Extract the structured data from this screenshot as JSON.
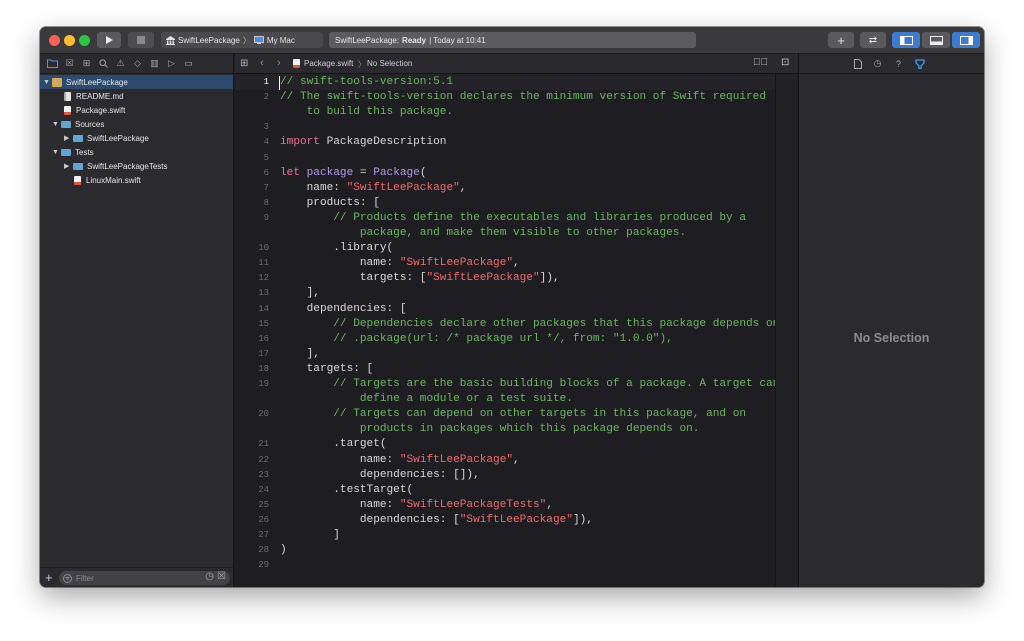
{
  "toolbar": {
    "scheme": "SwiftLeePackage",
    "destination": "My Mac",
    "status_prefix": "SwiftLeePackage:",
    "status_state": "Ready",
    "status_time": "| Today at 10:41"
  },
  "sidebar": {
    "items": [
      {
        "label": "SwiftLeePackage"
      },
      {
        "label": "README.md"
      },
      {
        "label": "Package.swift"
      },
      {
        "label": "Sources"
      },
      {
        "label": "SwiftLeePackage"
      },
      {
        "label": "Tests"
      },
      {
        "label": "SwiftLeePackageTests"
      },
      {
        "label": "LinuxMain.swift"
      }
    ],
    "filter_placeholder": "Filter"
  },
  "jumpbar": {
    "file": "Package.swift",
    "selection": "No Selection"
  },
  "editor": {
    "current_line": 1,
    "lines": [
      {
        "num": "1",
        "tokens": [
          {
            "t": "// swift-tools-version:5.1",
            "c": "c"
          }
        ]
      },
      {
        "num": "2",
        "tokens": [
          {
            "t": "// The swift-tools-version declares the minimum version of Swift required",
            "c": "c"
          }
        ]
      },
      {
        "num": "",
        "tokens": [
          {
            "t": "    to build this package.",
            "c": "c"
          }
        ]
      },
      {
        "num": "3",
        "tokens": []
      },
      {
        "num": "4",
        "tokens": [
          {
            "t": "import",
            "c": "k"
          },
          {
            "t": " PackageDescription",
            "c": "n"
          }
        ]
      },
      {
        "num": "5",
        "tokens": []
      },
      {
        "num": "6",
        "tokens": [
          {
            "t": "let",
            "c": "k"
          },
          {
            "t": " package",
            "c": "t"
          },
          {
            "t": " = ",
            "c": "n"
          },
          {
            "t": "Package",
            "c": "t"
          },
          {
            "t": "(",
            "c": "n"
          }
        ]
      },
      {
        "num": "7",
        "tokens": [
          {
            "t": "    name: ",
            "c": "n"
          },
          {
            "t": "\"SwiftLeePackage\"",
            "c": "s"
          },
          {
            "t": ",",
            "c": "n"
          }
        ]
      },
      {
        "num": "8",
        "tokens": [
          {
            "t": "    products: [",
            "c": "n"
          }
        ]
      },
      {
        "num": "9",
        "tokens": [
          {
            "t": "        // Products define the executables and libraries produced by a",
            "c": "c"
          }
        ]
      },
      {
        "num": "",
        "tokens": [
          {
            "t": "            package, and make them visible to other packages.",
            "c": "c"
          }
        ]
      },
      {
        "num": "10",
        "tokens": [
          {
            "t": "        .library(",
            "c": "n"
          }
        ]
      },
      {
        "num": "11",
        "tokens": [
          {
            "t": "            name: ",
            "c": "n"
          },
          {
            "t": "\"SwiftLeePackage\"",
            "c": "s"
          },
          {
            "t": ",",
            "c": "n"
          }
        ]
      },
      {
        "num": "12",
        "tokens": [
          {
            "t": "            targets: [",
            "c": "n"
          },
          {
            "t": "\"SwiftLeePackage\"",
            "c": "s"
          },
          {
            "t": "]),",
            "c": "n"
          }
        ]
      },
      {
        "num": "13",
        "tokens": [
          {
            "t": "    ],",
            "c": "n"
          }
        ]
      },
      {
        "num": "14",
        "tokens": [
          {
            "t": "    dependencies: [",
            "c": "n"
          }
        ]
      },
      {
        "num": "15",
        "tokens": [
          {
            "t": "        // Dependencies declare other packages that this package depends on.",
            "c": "c"
          }
        ]
      },
      {
        "num": "16",
        "tokens": [
          {
            "t": "        // .package(url: /* package url */, from: \"1.0.0\"),",
            "c": "c"
          }
        ]
      },
      {
        "num": "17",
        "tokens": [
          {
            "t": "    ],",
            "c": "n"
          }
        ]
      },
      {
        "num": "18",
        "tokens": [
          {
            "t": "    targets: [",
            "c": "n"
          }
        ]
      },
      {
        "num": "19",
        "tokens": [
          {
            "t": "        // Targets are the basic building blocks of a package. A target can",
            "c": "c"
          }
        ]
      },
      {
        "num": "",
        "tokens": [
          {
            "t": "            define a module or a test suite.",
            "c": "c"
          }
        ]
      },
      {
        "num": "20",
        "tokens": [
          {
            "t": "        // Targets can depend on other targets in this package, and on",
            "c": "c"
          }
        ]
      },
      {
        "num": "",
        "tokens": [
          {
            "t": "            products in packages which this package depends on.",
            "c": "c"
          }
        ]
      },
      {
        "num": "21",
        "tokens": [
          {
            "t": "        .target(",
            "c": "n"
          }
        ]
      },
      {
        "num": "22",
        "tokens": [
          {
            "t": "            name: ",
            "c": "n"
          },
          {
            "t": "\"SwiftLeePackage\"",
            "c": "s"
          },
          {
            "t": ",",
            "c": "n"
          }
        ]
      },
      {
        "num": "23",
        "tokens": [
          {
            "t": "            dependencies: []),",
            "c": "n"
          }
        ]
      },
      {
        "num": "24",
        "tokens": [
          {
            "t": "        .testTarget(",
            "c": "n"
          }
        ]
      },
      {
        "num": "25",
        "tokens": [
          {
            "t": "            name: ",
            "c": "n"
          },
          {
            "t": "\"SwiftLeePackageTests\"",
            "c": "s"
          },
          {
            "t": ",",
            "c": "n"
          }
        ]
      },
      {
        "num": "26",
        "tokens": [
          {
            "t": "            dependencies: [",
            "c": "n"
          },
          {
            "t": "\"SwiftLeePackage\"",
            "c": "s"
          },
          {
            "t": "]),",
            "c": "n"
          }
        ]
      },
      {
        "num": "27",
        "tokens": [
          {
            "t": "        ]",
            "c": "n"
          }
        ]
      },
      {
        "num": "28",
        "tokens": [
          {
            "t": ")",
            "c": "n"
          }
        ]
      },
      {
        "num": "29",
        "tokens": []
      }
    ]
  },
  "inspector": {
    "empty_label": "No Selection"
  },
  "colors": {
    "accent": "#3f9bf7",
    "comment": "#6bb85f",
    "string": "#f06b6b",
    "keyword": "#f56d9b",
    "type": "#b89aee",
    "close": "#fe5f57",
    "minimize": "#febc2e",
    "zoom": "#28c840"
  },
  "icons": {
    "run": "play-icon",
    "stop": "stop-icon",
    "library": "plus-icon",
    "review": "arrows-icon",
    "filter": "filter-icon"
  }
}
